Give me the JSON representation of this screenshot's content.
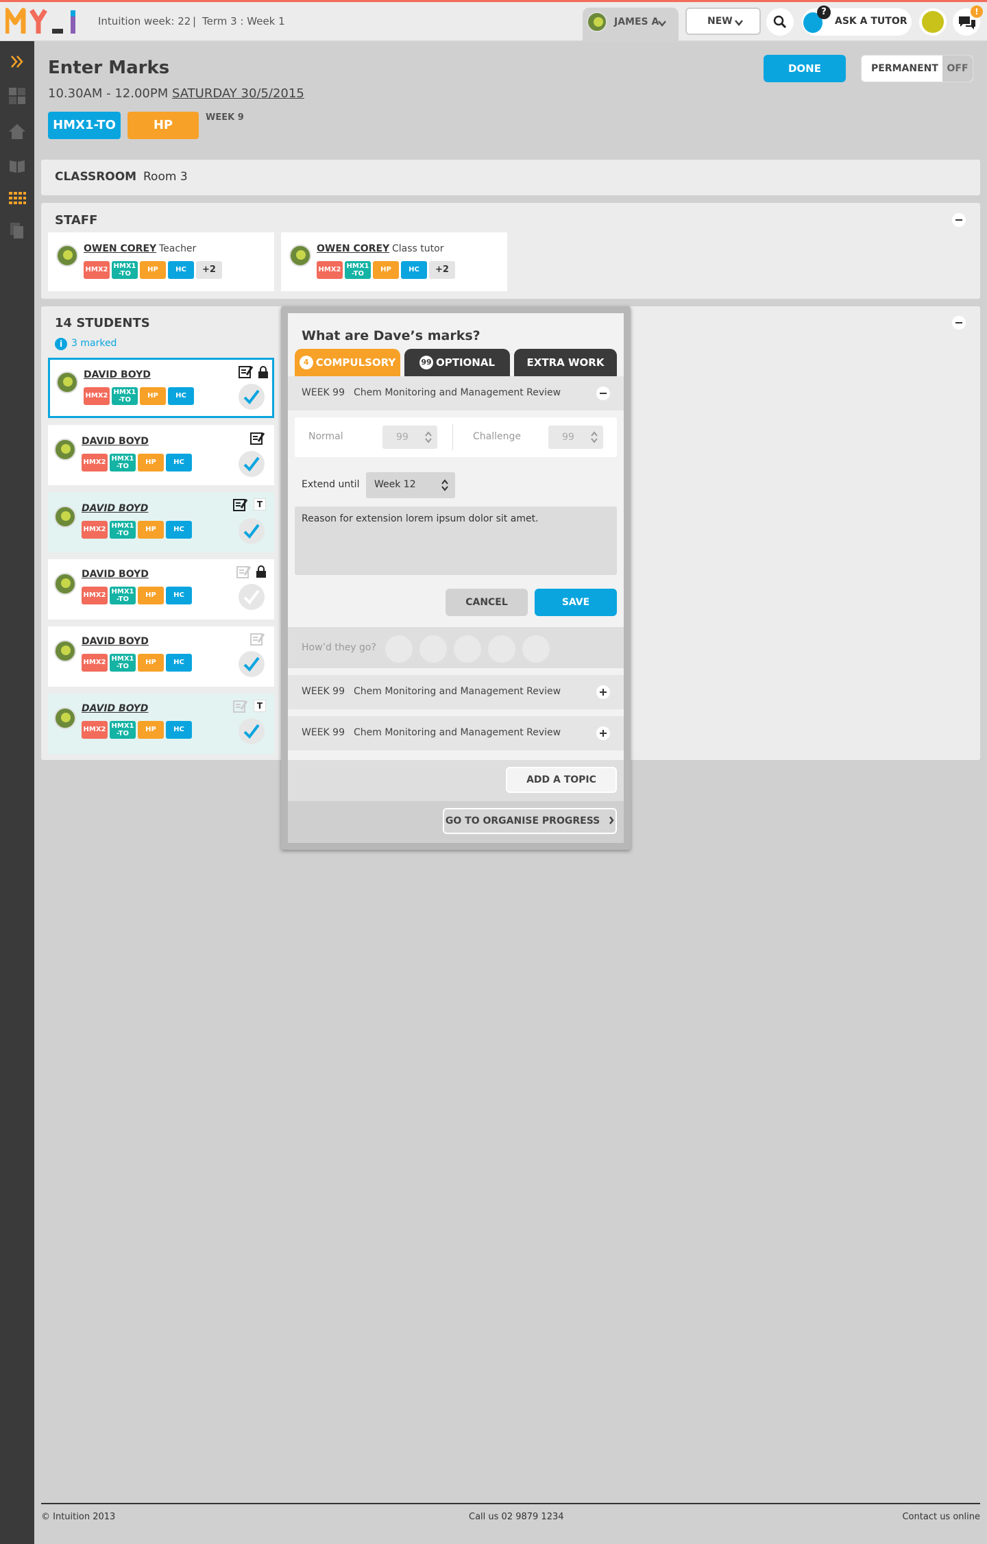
{
  "topbar": {
    "intuition_week": "Intuition week: 22",
    "separator": "|",
    "term": "Term 3 : Week 1",
    "user_name": "JAMES A",
    "new_label": "NEW",
    "ask_tutor_label": "ASK A TUTOR",
    "tutor_badge": "?",
    "chat_badge": "!"
  },
  "page": {
    "title": "Enter Marks",
    "time": "10.30AM - 12.00PM",
    "date": "SATURDAY 30/5/2015",
    "class_tag": "HMX1-TO",
    "subject_tag": "HP",
    "week": "WEEK 9",
    "done_label": "DONE",
    "permanent_label": "PERMANENT",
    "toggle_state": "OFF"
  },
  "classroom": {
    "label": "CLASSROOM",
    "room": "Room 3"
  },
  "staff": {
    "title": "STAFF",
    "members": [
      {
        "name": "OWEN COREY",
        "role": "Teacher",
        "chips": [
          "HMX2",
          "HMX1\n-TO",
          "HP",
          "HC"
        ],
        "more": "+2"
      },
      {
        "name": "OWEN COREY",
        "role": "Class tutor",
        "chips": [
          "HMX2",
          "HMX1\n-TO",
          "HP",
          "HC"
        ],
        "more": "+2"
      }
    ]
  },
  "students": {
    "title": "14 STUDENTS",
    "marked_icon": "i",
    "marked": "3 marked",
    "list": [
      {
        "name": "DAVID BOYD",
        "chips": [
          "HMX2",
          "HMX1\n-TO",
          "HP",
          "HC"
        ]
      },
      {
        "name": "DAVID BOYD",
        "chips": [
          "HMX2",
          "HMX1\n-TO",
          "HP",
          "HC"
        ]
      },
      {
        "name": "DAVID BOYD",
        "chips": [
          "HMX2",
          "HMX1\n-TO",
          "HP",
          "HC"
        ],
        "badge": "T"
      },
      {
        "name": "DAVID BOYD",
        "chips": [
          "HMX2",
          "HMX1\n-TO",
          "HP",
          "HC"
        ]
      },
      {
        "name": "DAVID BOYD",
        "chips": [
          "HMX2",
          "HMX1\n-TO",
          "HP",
          "HC"
        ]
      },
      {
        "name": "DAVID BOYD",
        "chips": [
          "HMX2",
          "HMX1\n-TO",
          "HP",
          "HC"
        ],
        "badge": "T"
      }
    ]
  },
  "modal": {
    "question": "What are Dave’s marks?",
    "tabs": [
      {
        "count": "4",
        "label": "COMPULSORY"
      },
      {
        "count": "99",
        "label": "OPTIONAL"
      },
      {
        "count": "",
        "label": "EXTRA WORK"
      }
    ],
    "topics": [
      {
        "week": "WEEK 99",
        "name": "Chem Monitoring and Management Review"
      },
      {
        "week": "WEEK 99",
        "name": "Chem Monitoring and Management Review"
      },
      {
        "week": "WEEK 99",
        "name": "Chem Monitoring and Management Review"
      }
    ],
    "normal_label": "Normal",
    "normal_value": "99",
    "challenge_label": "Challenge",
    "challenge_value": "99",
    "extend_label": "Extend until",
    "extend_value": "Week 12",
    "reason_text": "Reason for extension lorem ipsum dolor sit amet.",
    "cancel_label": "CANCEL",
    "save_label": "SAVE",
    "rating_label": "How’d they go?",
    "add_topic_label": "ADD A TOPIC",
    "organise_label": "GO TO ORGANISE PROGRESS"
  },
  "footer": {
    "copyright": "© Intuition 2013",
    "phone": "Call us 02 9879 1234",
    "contact": "Contact us online"
  },
  "colors": {
    "accent_blue": "#0aa5df",
    "hmx2": "#f26b5b",
    "hmx1_to": "#14b3a4",
    "hp": "#f7a128",
    "hc": "#0aa5df",
    "tab_compulsory": "#f7a128",
    "tab_dark": "#3a3a3a"
  }
}
